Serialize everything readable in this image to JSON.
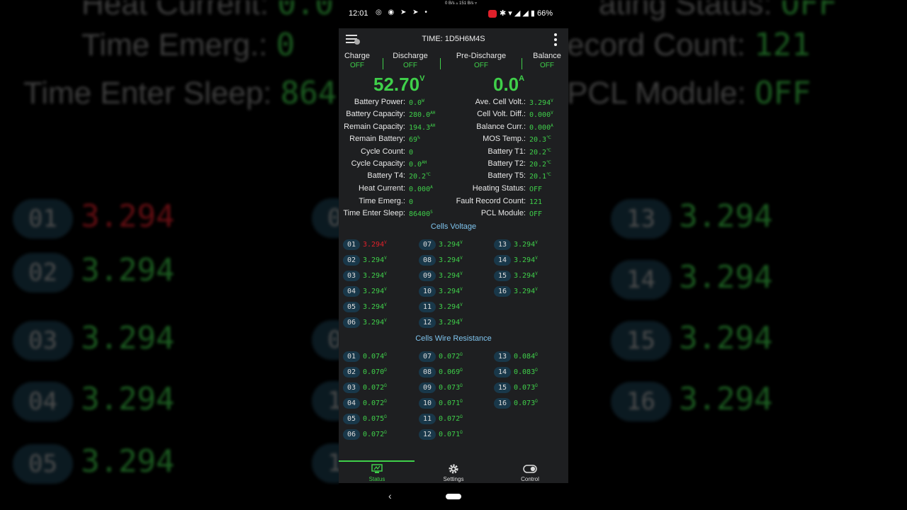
{
  "statusbar": {
    "time": "12:01",
    "net": "0 B/s ▵   151 B/s ▿",
    "battery": "66%"
  },
  "appbar": {
    "title": "TIME: 1D5H6M4S"
  },
  "switches": [
    {
      "label": "Charge",
      "value": "OFF"
    },
    {
      "label": "Discharge",
      "value": "OFF"
    },
    {
      "label": "Pre-Discharge",
      "value": "OFF"
    },
    {
      "label": "Balance",
      "value": "OFF"
    }
  ],
  "voltage": {
    "value": "52.70",
    "unit": "V"
  },
  "current": {
    "value": "0.0",
    "unit": "A"
  },
  "left_info": [
    {
      "label": "Battery Power:",
      "value": "0.0",
      "unit": "W"
    },
    {
      "label": "Battery Capacity:",
      "value": "280.0",
      "unit": "AH"
    },
    {
      "label": "Remain Capacity:",
      "value": "194.3",
      "unit": "AH"
    },
    {
      "label": "Remain Battery:",
      "value": "69",
      "unit": "%"
    },
    {
      "label": "Cycle Count:",
      "value": "0",
      "unit": ""
    },
    {
      "label": "Cycle Capacity:",
      "value": "0.0",
      "unit": "AH"
    },
    {
      "label": "Battery T4:",
      "value": "20.2",
      "unit": "℃"
    },
    {
      "label": "Heat Current:",
      "value": "0.000",
      "unit": "A"
    },
    {
      "label": "Time Emerg.:",
      "value": "0",
      "unit": ""
    },
    {
      "label": "Time Enter Sleep:",
      "value": "86400",
      "unit": "S"
    }
  ],
  "right_info": [
    {
      "label": "Ave. Cell Volt.:",
      "value": "3.294",
      "unit": "V"
    },
    {
      "label": "Cell Volt. Diff.:",
      "value": "0.000",
      "unit": "V"
    },
    {
      "label": "Balance Curr.:",
      "value": "0.000",
      "unit": "A"
    },
    {
      "label": "MOS Temp.:",
      "value": "20.3",
      "unit": "℃"
    },
    {
      "label": "Battery T1:",
      "value": "20.2",
      "unit": "℃"
    },
    {
      "label": "Battery T2:",
      "value": "20.2",
      "unit": "℃"
    },
    {
      "label": "Battery T5:",
      "value": "20.1",
      "unit": "℃"
    },
    {
      "label": "Heating Status:",
      "value": "OFF",
      "unit": ""
    },
    {
      "label": "Fault Record Count:",
      "value": "121",
      "unit": ""
    },
    {
      "label": "PCL Module:",
      "value": "OFF",
      "unit": ""
    }
  ],
  "cells_voltage": {
    "title": "Cells Voltage",
    "unit": "V",
    "items": [
      {
        "num": "01",
        "value": "3.294"
      },
      {
        "num": "02",
        "value": "3.294"
      },
      {
        "num": "03",
        "value": "3.294"
      },
      {
        "num": "04",
        "value": "3.294"
      },
      {
        "num": "05",
        "value": "3.294"
      },
      {
        "num": "06",
        "value": "3.294"
      },
      {
        "num": "07",
        "value": "3.294"
      },
      {
        "num": "08",
        "value": "3.294"
      },
      {
        "num": "09",
        "value": "3.294"
      },
      {
        "num": "10",
        "value": "3.294"
      },
      {
        "num": "11",
        "value": "3.294"
      },
      {
        "num": "12",
        "value": "3.294"
      },
      {
        "num": "13",
        "value": "3.294"
      },
      {
        "num": "14",
        "value": "3.294"
      },
      {
        "num": "15",
        "value": "3.294"
      },
      {
        "num": "16",
        "value": "3.294"
      }
    ]
  },
  "cells_resistance": {
    "title": "Cells Wire Resistance",
    "unit": "Ω",
    "items": [
      {
        "num": "01",
        "value": "0.074"
      },
      {
        "num": "02",
        "value": "0.070"
      },
      {
        "num": "03",
        "value": "0.072"
      },
      {
        "num": "04",
        "value": "0.072"
      },
      {
        "num": "05",
        "value": "0.075"
      },
      {
        "num": "06",
        "value": "0.072"
      },
      {
        "num": "07",
        "value": "0.072"
      },
      {
        "num": "08",
        "value": "0.069"
      },
      {
        "num": "09",
        "value": "0.073"
      },
      {
        "num": "10",
        "value": "0.071"
      },
      {
        "num": "11",
        "value": "0.072"
      },
      {
        "num": "12",
        "value": "0.071"
      },
      {
        "num": "13",
        "value": "0.084"
      },
      {
        "num": "14",
        "value": "0.083"
      },
      {
        "num": "15",
        "value": "0.073"
      },
      {
        "num": "16",
        "value": "0.073"
      }
    ]
  },
  "bottom_nav": [
    {
      "label": "Status",
      "icon": "monitor-icon",
      "active": true
    },
    {
      "label": "Settings",
      "icon": "gear-icon",
      "active": false
    },
    {
      "label": "Control",
      "icon": "toggle-icon",
      "active": false
    }
  ],
  "background": {
    "rows": [
      {
        "label": "Heat Current:",
        "value": "0.0"
      },
      {
        "label": "Time Emerg.:",
        "value": "0"
      },
      {
        "label": "Time Enter Sleep:",
        "value": "864"
      },
      {
        "label": "ating Status:",
        "value": "OFF"
      },
      {
        "label": "ecord Count:",
        "value": "121"
      },
      {
        "label": "PCL Module:",
        "value": "OFF"
      }
    ],
    "left_cells": [
      "01",
      "02",
      "03",
      "04",
      "05"
    ],
    "right_cells": [
      "13",
      "14",
      "15",
      "16"
    ],
    "cell_value": "3.294",
    "mid_fragments": [
      "0",
      "0",
      "0",
      "1",
      "1"
    ]
  },
  "colors": {
    "accent": "#3fcf4a",
    "alert": "#e0202a",
    "section": "#7fc4ee"
  }
}
